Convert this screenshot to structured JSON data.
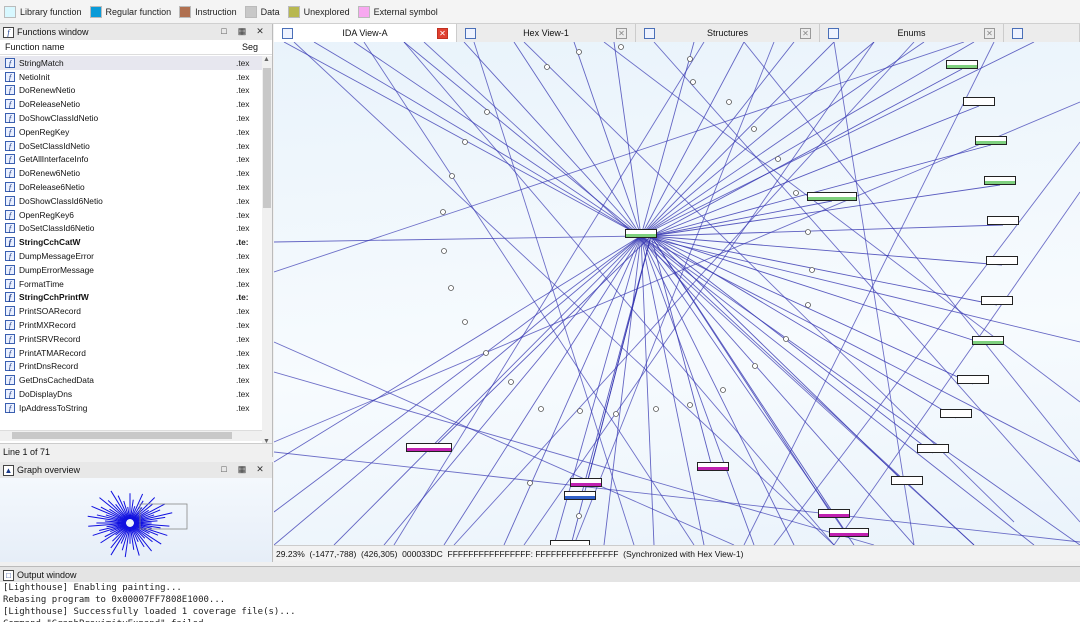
{
  "legend": [
    {
      "label": "Library function",
      "color": "#d8f8ff"
    },
    {
      "label": "Regular function",
      "color": "#0a9bd8"
    },
    {
      "label": "Instruction",
      "color": "#b07050"
    },
    {
      "label": "Data",
      "color": "#c8c8c8"
    },
    {
      "label": "Unexplored",
      "color": "#b8b850"
    },
    {
      "label": "External symbol",
      "color": "#f8a8f0"
    }
  ],
  "functions_window": {
    "title": "Functions window",
    "col_name": "Function name",
    "col_seg": "Seg",
    "items": [
      {
        "name": "StringMatch",
        "seg": ".tex",
        "bold": false
      },
      {
        "name": "NetioInit",
        "seg": ".tex",
        "bold": false
      },
      {
        "name": "DoRenewNetio",
        "seg": ".tex",
        "bold": false
      },
      {
        "name": "DoReleaseNetio",
        "seg": ".tex",
        "bold": false
      },
      {
        "name": "DoShowClassIdNetio",
        "seg": ".tex",
        "bold": false
      },
      {
        "name": "OpenRegKey",
        "seg": ".tex",
        "bold": false
      },
      {
        "name": "DoSetClassIdNetio",
        "seg": ".tex",
        "bold": false
      },
      {
        "name": "GetAllInterfaceInfo",
        "seg": ".tex",
        "bold": false
      },
      {
        "name": "DoRenew6Netio",
        "seg": ".tex",
        "bold": false
      },
      {
        "name": "DoRelease6Netio",
        "seg": ".tex",
        "bold": false
      },
      {
        "name": "DoShowClassId6Netio",
        "seg": ".tex",
        "bold": false
      },
      {
        "name": "OpenRegKey6",
        "seg": ".tex",
        "bold": false
      },
      {
        "name": "DoSetClassId6Netio",
        "seg": ".tex",
        "bold": false
      },
      {
        "name": "StringCchCatW",
        "seg": ".te:",
        "bold": true
      },
      {
        "name": "DumpMessageError",
        "seg": ".tex",
        "bold": false
      },
      {
        "name": "DumpErrorMessage",
        "seg": ".tex",
        "bold": false
      },
      {
        "name": "FormatTime",
        "seg": ".tex",
        "bold": false
      },
      {
        "name": "StringCchPrintfW",
        "seg": ".te:",
        "bold": true
      },
      {
        "name": "PrintSOARecord",
        "seg": ".tex",
        "bold": false
      },
      {
        "name": "PrintMXRecord",
        "seg": ".tex",
        "bold": false
      },
      {
        "name": "PrintSRVRecord",
        "seg": ".tex",
        "bold": false
      },
      {
        "name": "PrintATMARecord",
        "seg": ".tex",
        "bold": false
      },
      {
        "name": "PrintDnsRecord",
        "seg": ".tex",
        "bold": false
      },
      {
        "name": "GetDnsCachedData",
        "seg": ".tex",
        "bold": false
      },
      {
        "name": "DoDisplayDns",
        "seg": ".tex",
        "bold": false
      },
      {
        "name": "IpAddressToString",
        "seg": ".tex",
        "bold": false
      }
    ],
    "line_status": "Line 1 of 71"
  },
  "graph_overview": {
    "title": "Graph overview"
  },
  "tabs": [
    {
      "label": "IDA View-A",
      "active": true
    },
    {
      "label": "Hex View-1",
      "active": false
    },
    {
      "label": "Structures",
      "active": false
    },
    {
      "label": "Enums",
      "active": false
    }
  ],
  "graph_status": "29.23%  (-1477,-788)  (426,305)  000033DC  FFFFFFFFFFFFFFFF: FFFFFFFFFFFFFFFF  (Synchronized with Hex View-1)",
  "output_window": {
    "title": "Output window",
    "lines": [
      "[Lighthouse] Enabling painting...",
      "Rebasing program to 0x00007FF7808E1000...",
      "[Lighthouse] Successfully loaded 1 coverage file(s)...",
      "Command \"GraphProximityExpand\" failed"
    ]
  },
  "colors": {
    "edge": "#3434b0",
    "node_green": "#7ed07e",
    "node_magenta": "#c020b0",
    "node_blue": "#3060c8"
  }
}
